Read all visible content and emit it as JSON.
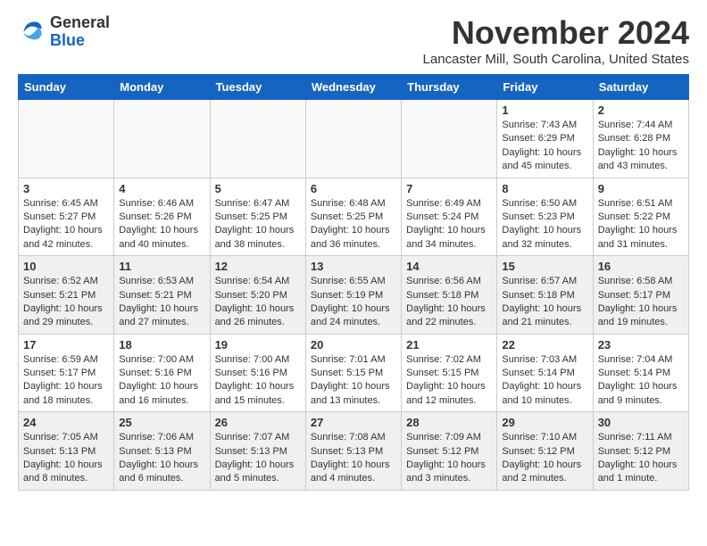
{
  "header": {
    "logo_general": "General",
    "logo_blue": "Blue",
    "month_title": "November 2024",
    "subtitle": "Lancaster Mill, South Carolina, United States"
  },
  "days_of_week": [
    "Sunday",
    "Monday",
    "Tuesday",
    "Wednesday",
    "Thursday",
    "Friday",
    "Saturday"
  ],
  "weeks": [
    [
      {
        "day": "",
        "info": "",
        "empty": true
      },
      {
        "day": "",
        "info": "",
        "empty": true
      },
      {
        "day": "",
        "info": "",
        "empty": true
      },
      {
        "day": "",
        "info": "",
        "empty": true
      },
      {
        "day": "",
        "info": "",
        "empty": true
      },
      {
        "day": "1",
        "info": "Sunrise: 7:43 AM\nSunset: 6:29 PM\nDaylight: 10 hours and 45 minutes.",
        "empty": false
      },
      {
        "day": "2",
        "info": "Sunrise: 7:44 AM\nSunset: 6:28 PM\nDaylight: 10 hours and 43 minutes.",
        "empty": false
      }
    ],
    [
      {
        "day": "3",
        "info": "Sunrise: 6:45 AM\nSunset: 5:27 PM\nDaylight: 10 hours and 42 minutes.",
        "empty": false
      },
      {
        "day": "4",
        "info": "Sunrise: 6:46 AM\nSunset: 5:26 PM\nDaylight: 10 hours and 40 minutes.",
        "empty": false
      },
      {
        "day": "5",
        "info": "Sunrise: 6:47 AM\nSunset: 5:25 PM\nDaylight: 10 hours and 38 minutes.",
        "empty": false
      },
      {
        "day": "6",
        "info": "Sunrise: 6:48 AM\nSunset: 5:25 PM\nDaylight: 10 hours and 36 minutes.",
        "empty": false
      },
      {
        "day": "7",
        "info": "Sunrise: 6:49 AM\nSunset: 5:24 PM\nDaylight: 10 hours and 34 minutes.",
        "empty": false
      },
      {
        "day": "8",
        "info": "Sunrise: 6:50 AM\nSunset: 5:23 PM\nDaylight: 10 hours and 32 minutes.",
        "empty": false
      },
      {
        "day": "9",
        "info": "Sunrise: 6:51 AM\nSunset: 5:22 PM\nDaylight: 10 hours and 31 minutes.",
        "empty": false
      }
    ],
    [
      {
        "day": "10",
        "info": "Sunrise: 6:52 AM\nSunset: 5:21 PM\nDaylight: 10 hours and 29 minutes.",
        "empty": false
      },
      {
        "day": "11",
        "info": "Sunrise: 6:53 AM\nSunset: 5:21 PM\nDaylight: 10 hours and 27 minutes.",
        "empty": false
      },
      {
        "day": "12",
        "info": "Sunrise: 6:54 AM\nSunset: 5:20 PM\nDaylight: 10 hours and 26 minutes.",
        "empty": false
      },
      {
        "day": "13",
        "info": "Sunrise: 6:55 AM\nSunset: 5:19 PM\nDaylight: 10 hours and 24 minutes.",
        "empty": false
      },
      {
        "day": "14",
        "info": "Sunrise: 6:56 AM\nSunset: 5:18 PM\nDaylight: 10 hours and 22 minutes.",
        "empty": false
      },
      {
        "day": "15",
        "info": "Sunrise: 6:57 AM\nSunset: 5:18 PM\nDaylight: 10 hours and 21 minutes.",
        "empty": false
      },
      {
        "day": "16",
        "info": "Sunrise: 6:58 AM\nSunset: 5:17 PM\nDaylight: 10 hours and 19 minutes.",
        "empty": false
      }
    ],
    [
      {
        "day": "17",
        "info": "Sunrise: 6:59 AM\nSunset: 5:17 PM\nDaylight: 10 hours and 18 minutes.",
        "empty": false
      },
      {
        "day": "18",
        "info": "Sunrise: 7:00 AM\nSunset: 5:16 PM\nDaylight: 10 hours and 16 minutes.",
        "empty": false
      },
      {
        "day": "19",
        "info": "Sunrise: 7:00 AM\nSunset: 5:16 PM\nDaylight: 10 hours and 15 minutes.",
        "empty": false
      },
      {
        "day": "20",
        "info": "Sunrise: 7:01 AM\nSunset: 5:15 PM\nDaylight: 10 hours and 13 minutes.",
        "empty": false
      },
      {
        "day": "21",
        "info": "Sunrise: 7:02 AM\nSunset: 5:15 PM\nDaylight: 10 hours and 12 minutes.",
        "empty": false
      },
      {
        "day": "22",
        "info": "Sunrise: 7:03 AM\nSunset: 5:14 PM\nDaylight: 10 hours and 10 minutes.",
        "empty": false
      },
      {
        "day": "23",
        "info": "Sunrise: 7:04 AM\nSunset: 5:14 PM\nDaylight: 10 hours and 9 minutes.",
        "empty": false
      }
    ],
    [
      {
        "day": "24",
        "info": "Sunrise: 7:05 AM\nSunset: 5:13 PM\nDaylight: 10 hours and 8 minutes.",
        "empty": false
      },
      {
        "day": "25",
        "info": "Sunrise: 7:06 AM\nSunset: 5:13 PM\nDaylight: 10 hours and 6 minutes.",
        "empty": false
      },
      {
        "day": "26",
        "info": "Sunrise: 7:07 AM\nSunset: 5:13 PM\nDaylight: 10 hours and 5 minutes.",
        "empty": false
      },
      {
        "day": "27",
        "info": "Sunrise: 7:08 AM\nSunset: 5:13 PM\nDaylight: 10 hours and 4 minutes.",
        "empty": false
      },
      {
        "day": "28",
        "info": "Sunrise: 7:09 AM\nSunset: 5:12 PM\nDaylight: 10 hours and 3 minutes.",
        "empty": false
      },
      {
        "day": "29",
        "info": "Sunrise: 7:10 AM\nSunset: 5:12 PM\nDaylight: 10 hours and 2 minutes.",
        "empty": false
      },
      {
        "day": "30",
        "info": "Sunrise: 7:11 AM\nSunset: 5:12 PM\nDaylight: 10 hours and 1 minute.",
        "empty": false
      }
    ]
  ]
}
